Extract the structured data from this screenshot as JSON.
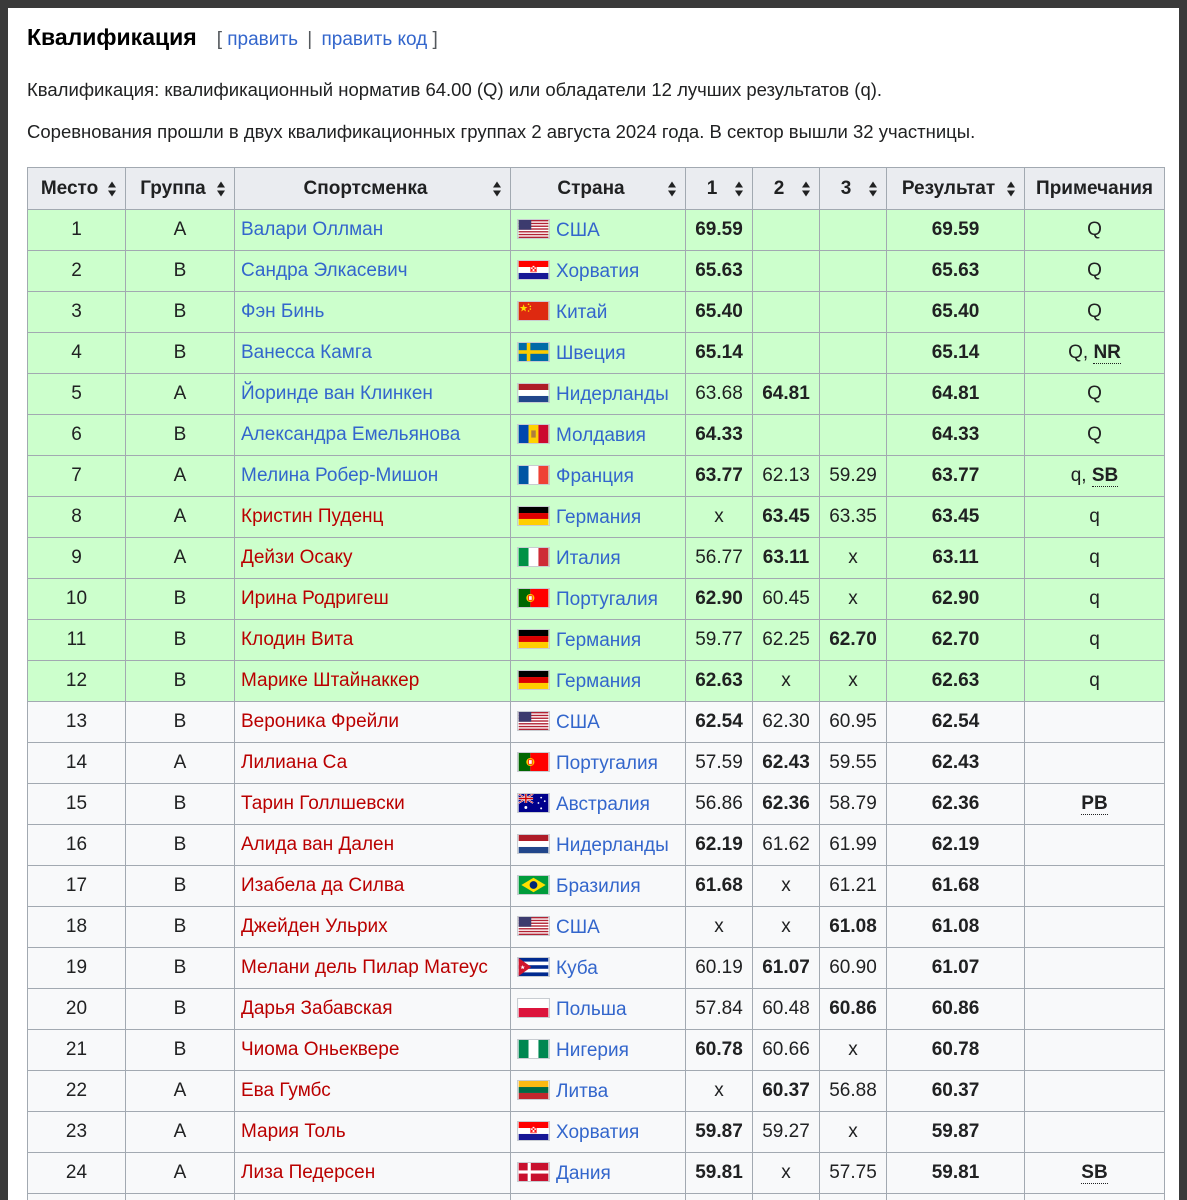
{
  "section": {
    "title": "Квалификация",
    "edit_open": "[",
    "edit_link": "править",
    "edit_sep": "|",
    "edit_code_link": "править код",
    "edit_close": "]"
  },
  "paragraphs": {
    "p1": "Квалификация: квалификационный норматив 64.00 (Q) или обладатели 12 лучших результатов (q).",
    "p2": "Соревнования прошли в двух квалификационных группах 2 августа 2024 года. В сектор вышли 32 участницы."
  },
  "table": {
    "headers": [
      "Место",
      "Группа",
      "Спортсменка",
      "Страна",
      "1",
      "2",
      "3",
      "Результат",
      "Примечания"
    ],
    "rows": [
      {
        "place": "1",
        "group": "A",
        "athlete": "Валари Оллман",
        "link": "blue",
        "flag": "usa",
        "country": "США",
        "a1": "69.59",
        "a2": "",
        "a3": "",
        "best": 1,
        "result": "69.59",
        "note": "Q",
        "note_bold": "",
        "qual": true
      },
      {
        "place": "2",
        "group": "B",
        "athlete": "Сандра Элкасевич",
        "link": "blue",
        "flag": "cro",
        "country": "Хорватия",
        "a1": "65.63",
        "a2": "",
        "a3": "",
        "best": 1,
        "result": "65.63",
        "note": "Q",
        "note_bold": "",
        "qual": true
      },
      {
        "place": "3",
        "group": "B",
        "athlete": "Фэн Бинь",
        "link": "blue",
        "flag": "chn",
        "country": "Китай",
        "a1": "65.40",
        "a2": "",
        "a3": "",
        "best": 1,
        "result": "65.40",
        "note": "Q",
        "note_bold": "",
        "qual": true
      },
      {
        "place": "4",
        "group": "B",
        "athlete": "Ванесса Камга",
        "link": "blue",
        "flag": "swe",
        "country": "Швеция",
        "a1": "65.14",
        "a2": "",
        "a3": "",
        "best": 1,
        "result": "65.14",
        "note": "Q, ",
        "note_bold": "NR",
        "qual": true
      },
      {
        "place": "5",
        "group": "A",
        "athlete": "Йоринде ван Клинкен",
        "link": "blue",
        "flag": "ned",
        "country": "Нидерланды",
        "a1": "63.68",
        "a2": "64.81",
        "a3": "",
        "best": 2,
        "result": "64.81",
        "note": "Q",
        "note_bold": "",
        "qual": true
      },
      {
        "place": "6",
        "group": "B",
        "athlete": "Александра Емельянова",
        "link": "blue",
        "flag": "mda",
        "country": "Молдавия",
        "a1": "64.33",
        "a2": "",
        "a3": "",
        "best": 1,
        "result": "64.33",
        "note": "Q",
        "note_bold": "",
        "qual": true
      },
      {
        "place": "7",
        "group": "A",
        "athlete": "Мелина Робер-Мишон",
        "link": "blue",
        "flag": "fra",
        "country": "Франция",
        "a1": "63.77",
        "a2": "62.13",
        "a3": "59.29",
        "best": 1,
        "result": "63.77",
        "note": "q, ",
        "note_bold": "SB",
        "qual": true
      },
      {
        "place": "8",
        "group": "A",
        "athlete": "Кристин Пуденц",
        "link": "red",
        "flag": "ger",
        "country": "Германия",
        "a1": "x",
        "a2": "63.45",
        "a3": "63.35",
        "best": 2,
        "result": "63.45",
        "note": "q",
        "note_bold": "",
        "qual": true
      },
      {
        "place": "9",
        "group": "A",
        "athlete": "Дейзи Осаку",
        "link": "red",
        "flag": "ita",
        "country": "Италия",
        "a1": "56.77",
        "a2": "63.11",
        "a3": "x",
        "best": 2,
        "result": "63.11",
        "note": "q",
        "note_bold": "",
        "qual": true
      },
      {
        "place": "10",
        "group": "B",
        "athlete": "Ирина Родригеш",
        "link": "red",
        "flag": "por",
        "country": "Португалия",
        "a1": "62.90",
        "a2": "60.45",
        "a3": "x",
        "best": 1,
        "result": "62.90",
        "note": "q",
        "note_bold": "",
        "qual": true
      },
      {
        "place": "11",
        "group": "B",
        "athlete": "Клодин Вита",
        "link": "red",
        "flag": "ger",
        "country": "Германия",
        "a1": "59.77",
        "a2": "62.25",
        "a3": "62.70",
        "best": 3,
        "result": "62.70",
        "note": "q",
        "note_bold": "",
        "qual": true
      },
      {
        "place": "12",
        "group": "B",
        "athlete": "Марике Штайнаккер",
        "link": "red",
        "flag": "ger",
        "country": "Германия",
        "a1": "62.63",
        "a2": "x",
        "a3": "x",
        "best": 1,
        "result": "62.63",
        "note": "q",
        "note_bold": "",
        "qual": true
      },
      {
        "place": "13",
        "group": "B",
        "athlete": "Вероника Фрейли",
        "link": "red",
        "flag": "usa",
        "country": "США",
        "a1": "62.54",
        "a2": "62.30",
        "a3": "60.95",
        "best": 1,
        "result": "62.54",
        "note": "",
        "note_bold": "",
        "qual": false
      },
      {
        "place": "14",
        "group": "A",
        "athlete": "Лилиана Са",
        "link": "red",
        "flag": "por",
        "country": "Португалия",
        "a1": "57.59",
        "a2": "62.43",
        "a3": "59.55",
        "best": 2,
        "result": "62.43",
        "note": "",
        "note_bold": "",
        "qual": false
      },
      {
        "place": "15",
        "group": "B",
        "athlete": "Тарин Голлшевски",
        "link": "red",
        "flag": "aus",
        "country": "Австралия",
        "a1": "56.86",
        "a2": "62.36",
        "a3": "58.79",
        "best": 2,
        "result": "62.36",
        "note": "",
        "note_bold": "PB",
        "qual": false
      },
      {
        "place": "16",
        "group": "B",
        "athlete": "Алида ван Дален",
        "link": "red",
        "flag": "ned",
        "country": "Нидерланды",
        "a1": "62.19",
        "a2": "61.62",
        "a3": "61.99",
        "best": 1,
        "result": "62.19",
        "note": "",
        "note_bold": "",
        "qual": false
      },
      {
        "place": "17",
        "group": "B",
        "athlete": "Изабела да Силва",
        "link": "red",
        "flag": "bra",
        "country": "Бразилия",
        "a1": "61.68",
        "a2": "x",
        "a3": "61.21",
        "best": 1,
        "result": "61.68",
        "note": "",
        "note_bold": "",
        "qual": false
      },
      {
        "place": "18",
        "group": "B",
        "athlete": "Джейден Ульрих",
        "link": "red",
        "flag": "usa",
        "country": "США",
        "a1": "x",
        "a2": "x",
        "a3": "61.08",
        "best": 3,
        "result": "61.08",
        "note": "",
        "note_bold": "",
        "qual": false
      },
      {
        "place": "19",
        "group": "B",
        "athlete": "Мелани дель Пилар Матеус",
        "link": "red",
        "flag": "cub",
        "country": "Куба",
        "a1": "60.19",
        "a2": "61.07",
        "a3": "60.90",
        "best": 2,
        "result": "61.07",
        "note": "",
        "note_bold": "",
        "qual": false
      },
      {
        "place": "20",
        "group": "B",
        "athlete": "Дарья Забавская",
        "link": "red",
        "flag": "pol",
        "country": "Польша",
        "a1": "57.84",
        "a2": "60.48",
        "a3": "60.86",
        "best": 3,
        "result": "60.86",
        "note": "",
        "note_bold": "",
        "qual": false
      },
      {
        "place": "21",
        "group": "B",
        "athlete": "Чиома Оньеквере",
        "link": "red",
        "flag": "nga",
        "country": "Нигерия",
        "a1": "60.78",
        "a2": "60.66",
        "a3": "x",
        "best": 1,
        "result": "60.78",
        "note": "",
        "note_bold": "",
        "qual": false
      },
      {
        "place": "22",
        "group": "A",
        "athlete": "Ева Гумбс",
        "link": "red",
        "flag": "ltu",
        "country": "Литва",
        "a1": "x",
        "a2": "60.37",
        "a3": "56.88",
        "best": 2,
        "result": "60.37",
        "note": "",
        "note_bold": "",
        "qual": false
      },
      {
        "place": "23",
        "group": "A",
        "athlete": "Мария Толь",
        "link": "red",
        "flag": "cro",
        "country": "Хорватия",
        "a1": "59.87",
        "a2": "59.27",
        "a3": "x",
        "best": 1,
        "result": "59.87",
        "note": "",
        "note_bold": "",
        "qual": false
      },
      {
        "place": "24",
        "group": "A",
        "athlete": "Лиза Педерсен",
        "link": "red",
        "flag": "den",
        "country": "Дания",
        "a1": "59.81",
        "a2": "x",
        "a3": "57.75",
        "best": 1,
        "result": "59.81",
        "note": "",
        "note_bold": "SB",
        "qual": false
      },
      {
        "place": "",
        "group": "",
        "athlete": "",
        "link": "red",
        "flag": "",
        "country": "",
        "a1": "",
        "a2": "",
        "a3": "",
        "best": 0,
        "result": "",
        "note": "",
        "note_bold": "",
        "qual": false
      }
    ]
  },
  "colors": {
    "qualified_row": "#ccffcc",
    "plain_row": "#f8f9fa",
    "link_blue": "#3366cc",
    "link_red": "#ba0000",
    "header_bg": "#eaecf0"
  }
}
